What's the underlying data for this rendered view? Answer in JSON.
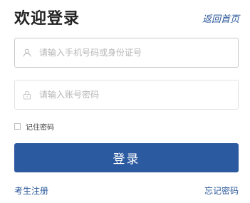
{
  "header": {
    "title": "欢迎登录",
    "back_home_label": "返回首页"
  },
  "form": {
    "phone_placeholder": "请输入手机号码或身份证号",
    "phone_value": "",
    "phone_icon": "user-icon",
    "password_placeholder": "请输入账号密码",
    "password_value": "",
    "password_icon": "lock-icon",
    "remember_label": "记住密码",
    "remember_checked": false,
    "login_label": "登录"
  },
  "footer": {
    "register_label": "考生注册",
    "forgot_label": "忘记密码"
  },
  "colors": {
    "primary": "#2c5aa0",
    "link": "#2a579a",
    "placeholder": "#b7b7b7"
  }
}
